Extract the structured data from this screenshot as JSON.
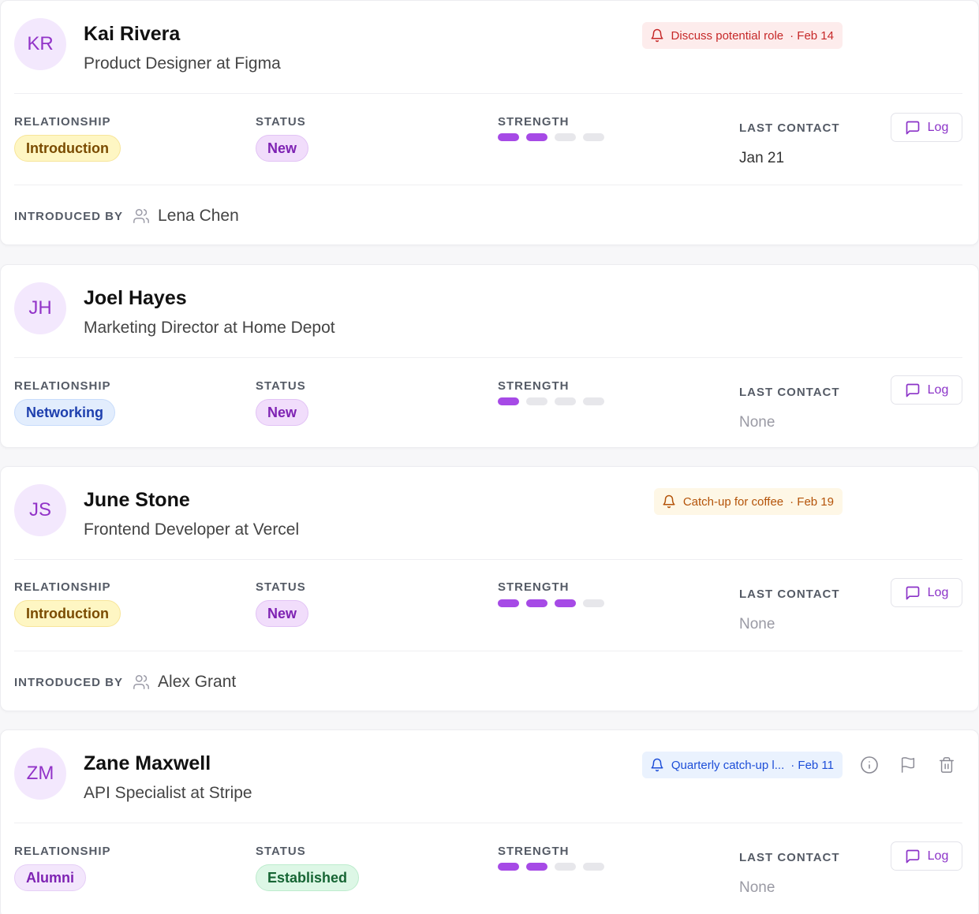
{
  "labels": {
    "relationship": "RELATIONSHIP",
    "status": "STATUS",
    "strength": "STRENGTH",
    "last_contact": "LAST CONTACT",
    "introduced_by": "INTRODUCED BY",
    "log": "Log"
  },
  "colors": {
    "accent": "#a64ae6",
    "pill_introduction_bg": "#fef6c3",
    "pill_introduction_fg": "#7a4b00",
    "pill_networking_bg": "#e2edfd",
    "pill_networking_fg": "#1e3fae",
    "pill_new_bg": "#f1ddfb",
    "pill_new_fg": "#7e22b3",
    "pill_alumni_bg": "#f3e6fc",
    "pill_alumni_fg": "#7e22b3",
    "pill_established_bg": "#ddf7e6",
    "pill_established_fg": "#166534"
  },
  "contacts": [
    {
      "initials": "KR",
      "name": "Kai Rivera",
      "subtitle": "Product Designer at Figma",
      "reminder": {
        "text": "Discuss potential role",
        "date": "· Feb 14",
        "tone": "red"
      },
      "relationship": "Introduction",
      "status": "New",
      "strength": 2,
      "strength_max": 4,
      "last_contact": "Jan 21",
      "introduced_by": "Lena Chen"
    },
    {
      "initials": "JH",
      "name": "Joel Hayes",
      "subtitle": "Marketing Director at Home Depot",
      "relationship": "Networking",
      "status": "New",
      "strength": 1,
      "strength_max": 4,
      "last_contact": "None"
    },
    {
      "initials": "JS",
      "name": "June Stone",
      "subtitle": "Frontend Developer at Vercel",
      "reminder": {
        "text": "Catch-up for coffee",
        "date": "· Feb 19",
        "tone": "amber"
      },
      "relationship": "Introduction",
      "status": "New",
      "strength": 3,
      "strength_max": 4,
      "last_contact": "None",
      "introduced_by": "Alex Grant"
    },
    {
      "initials": "ZM",
      "name": "Zane Maxwell",
      "subtitle": "API Specialist at Stripe",
      "reminder": {
        "text": "Quarterly catch-up l...",
        "date": "· Feb 11",
        "tone": "blue"
      },
      "relationship": "Alumni",
      "status": "Established",
      "strength": 2,
      "strength_max": 4,
      "last_contact": "None",
      "actions": [
        "info-icon",
        "flag-icon",
        "trash-icon"
      ]
    }
  ]
}
